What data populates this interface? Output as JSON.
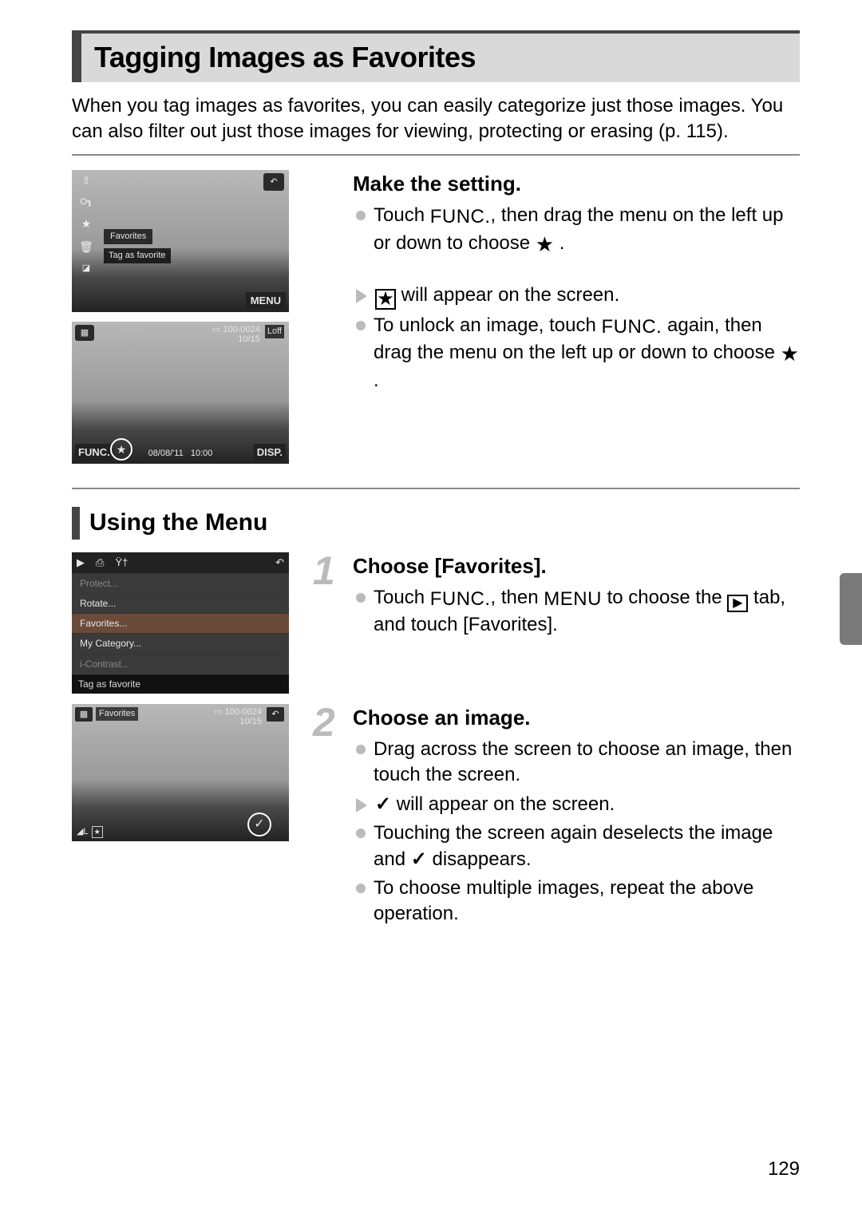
{
  "page_title": "Tagging Images as Favorites",
  "intro": "When you tag images as favorites, you can easily categorize just those images. You can also filter out just those images for viewing, protecting or erasing (p. 115).",
  "section1": {
    "heading": "Make the setting.",
    "b1a": "Touch ",
    "b1b": ", then drag the menu on the left up or down to choose ",
    "b1c": " .",
    "t1a": " will appear on the screen.",
    "b2a": "To unlock an image, touch ",
    "b2b": " again, then drag the menu on the left up or down to choose ",
    "b2c": " ."
  },
  "sub_heading": "Using the Menu",
  "step1": {
    "num": "1",
    "heading": "Choose [Favorites].",
    "b1a": "Touch ",
    "b1b": ", then ",
    "b1c": " to choose the ",
    "b1d": " tab, and touch [Favorites]."
  },
  "step2": {
    "num": "2",
    "heading": "Choose an image.",
    "b1": "Drag across the screen to choose an image, then touch the screen.",
    "t1": " will appear on the screen.",
    "b2a": "Touching the screen again deselects the image and ",
    "b2b": " disappears.",
    "b3": "To choose multiple images, repeat the above operation."
  },
  "labels": {
    "func": "FUNC.",
    "menu": "MENU",
    "disp": "DISP.",
    "loff": "Loff"
  },
  "shot1": {
    "favorites": "Favorites",
    "tag": "Tag as favorite",
    "menu": "MENU"
  },
  "shot2": {
    "folder": "100-0024",
    "counter": "10/15",
    "date": "08/08/'11",
    "time": "10:00"
  },
  "shot3": {
    "items": {
      "i0": "Protect...",
      "i1": "Rotate...",
      "i2": "Favorites...",
      "i3": "My Category...",
      "i4": "i-Contrast..."
    },
    "caption": "Tag as favorite"
  },
  "shot4": {
    "title": "Favorites",
    "folder": "100-0024",
    "counter": "10/15"
  },
  "page_number": "129"
}
